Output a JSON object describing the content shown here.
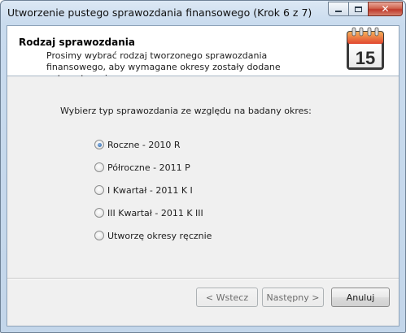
{
  "window": {
    "title": "Utworzenie pustego sprawozdania finansowego (Krok 6 z 7)",
    "controls": {
      "minimize": "minimize-icon",
      "maximize": "maximize-icon",
      "close": "close-icon"
    }
  },
  "header": {
    "title": "Rodzaj sprawozdania",
    "description": "Prosimy wybrać rodzaj tworzonego sprawozdania finansowego, aby wymagane okresy zostały dodane automatycznie.",
    "calendar_day": "15"
  },
  "main": {
    "question": "Wybierz typ sprawozdania ze względu na badany okres:",
    "options": [
      {
        "label": "Roczne - 2010 R",
        "checked": true
      },
      {
        "label": "Półroczne - 2011 P",
        "checked": false
      },
      {
        "label": "I Kwartał - 2011 K I",
        "checked": false
      },
      {
        "label": "III Kwartał - 2011 K III",
        "checked": false
      },
      {
        "label": "Utworzę okresy ręcznie",
        "checked": false
      }
    ]
  },
  "buttons": {
    "back": "< Wstecz",
    "next": "Następny >",
    "cancel": "Anuluj"
  },
  "colors": {
    "titlebar": "#c9dbee",
    "header_bg": "#ffffff",
    "body_bg": "#f0f0f0",
    "calendar_red": "#e0452d",
    "calendar_orange": "#f39a3a"
  }
}
